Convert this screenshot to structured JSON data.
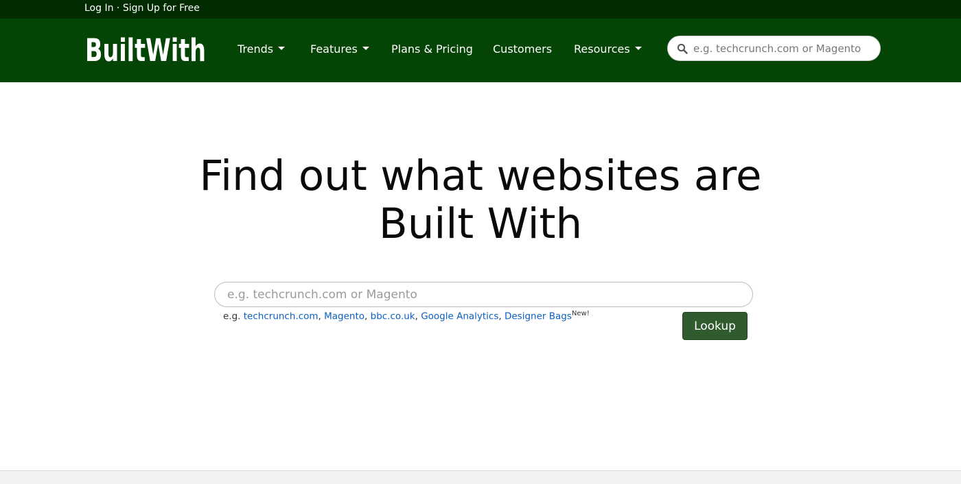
{
  "topbar": {
    "login_label": "Log In",
    "separator": "·",
    "signup_label": "Sign Up for Free"
  },
  "nav": {
    "logo_text": "BuiltWith",
    "items": [
      {
        "label": "Trends",
        "has_dropdown": true
      },
      {
        "label": "Features",
        "has_dropdown": true
      },
      {
        "label": "Plans & Pricing",
        "has_dropdown": false
      },
      {
        "label": "Customers",
        "has_dropdown": false
      },
      {
        "label": "Resources",
        "has_dropdown": true
      }
    ],
    "search_placeholder": "e.g. techcrunch.com or Magento",
    "search_icon": "search-icon"
  },
  "hero": {
    "headline_line1": "Find out what websites are",
    "headline_line2": "Built With",
    "search_placeholder": "e.g. techcrunch.com or Magento",
    "examples_prefix": "e.g.",
    "examples": [
      "techcrunch.com",
      "Magento",
      "bbc.co.uk",
      "Google Analytics",
      "Designer Bags"
    ],
    "examples_separator": ",",
    "new_badge": "New!",
    "lookup_label": "Lookup"
  },
  "colors": {
    "topbar_bg": "#022b02",
    "navbar_bg": "#044404",
    "link": "#0b5fc0",
    "button_bg": "#2f5b2f"
  }
}
